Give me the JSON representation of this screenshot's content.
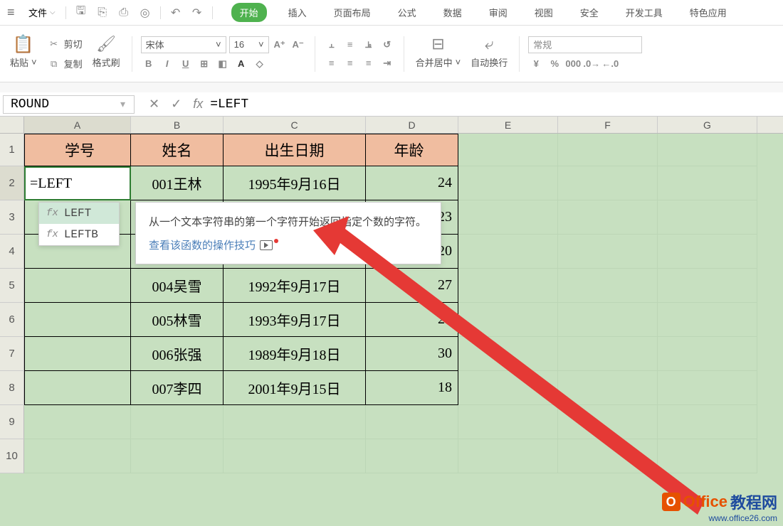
{
  "menubar": {
    "file_label": "文件",
    "tabs": [
      "开始",
      "插入",
      "页面布局",
      "公式",
      "数据",
      "审阅",
      "视图",
      "安全",
      "开发工具",
      "特色应用"
    ],
    "active_tab_index": 0
  },
  "ribbon": {
    "paste_label": "粘贴",
    "cut_label": "剪切",
    "copy_label": "复制",
    "format_painter": "格式刷",
    "font_name": "宋体",
    "font_size": "16",
    "merge_label": "合并居中",
    "wrap_label": "自动换行",
    "find_placeholder": "常规"
  },
  "formula_bar": {
    "name_box": "ROUND",
    "formula": "=LEFT"
  },
  "columns": [
    "A",
    "B",
    "C",
    "D",
    "E",
    "F",
    "G"
  ],
  "sheet": {
    "headers": {
      "A": "学号",
      "B": "姓名",
      "C": "出生日期",
      "D": "年龄"
    },
    "active_cell_value": "=LEFT",
    "rows": [
      {
        "B": "001王林",
        "C": "1995年9月16日",
        "D": "24"
      },
      {
        "B": "",
        "C": "",
        "D": "23"
      },
      {
        "B": "",
        "C": "",
        "D": "20"
      },
      {
        "B": "004吴雪",
        "C": "1992年9月17日",
        "D": "27"
      },
      {
        "B": "005林雪",
        "C": "1993年9月17日",
        "D": "26"
      },
      {
        "B": "006张强",
        "C": "1989年9月18日",
        "D": "30"
      },
      {
        "B": "007李四",
        "C": "2001年9月15日",
        "D": "18"
      }
    ]
  },
  "autocomplete": {
    "items": [
      "LEFT",
      "LEFTB"
    ],
    "selected_index": 0
  },
  "tooltip": {
    "desc": "从一个文本字符串的第一个字符开始返回指定个数的字符。",
    "link": "查看该函数的操作技巧"
  },
  "watermark": {
    "text1": "Office",
    "text2": "教程网",
    "url": "www.office26.com"
  }
}
